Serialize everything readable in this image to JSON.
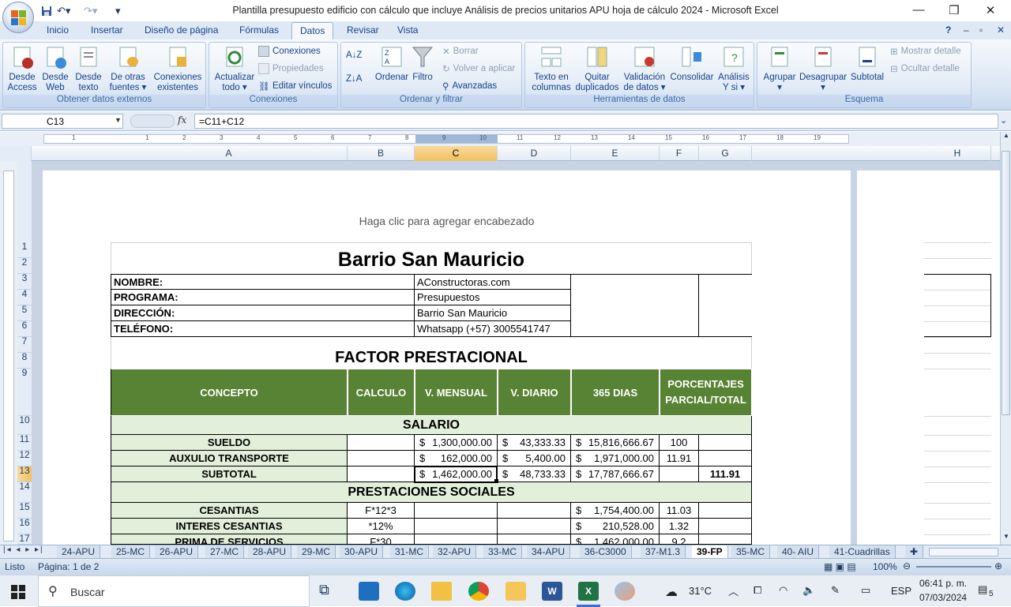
{
  "window": {
    "title": "Plantilla presupuesto edificio con cálculo que incluye Análisis de precios unitarios APU  hoja de cálculo 2024 - Microsoft Excel"
  },
  "ribbon": {
    "tabs": [
      "Inicio",
      "Insertar",
      "Diseño de página",
      "Fórmulas",
      "Datos",
      "Revisar",
      "Vista"
    ],
    "active_tab": "Datos",
    "groups": {
      "external": {
        "label": "Obtener datos externos",
        "buttons": [
          [
            "Desde",
            "Access"
          ],
          [
            "Desde",
            "Web"
          ],
          [
            "Desde",
            "texto"
          ],
          [
            "De otras",
            "fuentes ▾"
          ],
          [
            "Conexiones",
            "existentes"
          ]
        ]
      },
      "connections": {
        "label": "Conexiones",
        "refresh": [
          "Actualizar",
          "todo ▾"
        ],
        "small": [
          "Conexiones",
          "Propiedades",
          "Editar vínculos"
        ]
      },
      "sort": {
        "label": "Ordenar y filtrar",
        "sort": "Ordenar",
        "filter": "Filtro",
        "small": [
          "Borrar",
          "Volver a aplicar",
          "Avanzadas"
        ]
      },
      "tools": {
        "label": "Herramientas de datos",
        "buttons": [
          [
            "Texto en",
            "columnas"
          ],
          [
            "Quitar",
            "duplicados"
          ],
          [
            "Validación",
            "de datos ▾"
          ],
          [
            "Consolidar",
            ""
          ],
          [
            "Análisis",
            "Y si ▾"
          ]
        ]
      },
      "outline": {
        "label": "Esquema",
        "buttons": [
          [
            "Agrupar",
            "▾"
          ],
          [
            "Desagrupar",
            "▾"
          ],
          [
            "Subtotal",
            ""
          ]
        ],
        "small": [
          "Mostrar detalle",
          "Ocultar detalle"
        ]
      }
    }
  },
  "formula_bar": {
    "cell": "C13",
    "fx": "fx",
    "formula": "=C11+C12"
  },
  "columns": [
    "A",
    "B",
    "C",
    "D",
    "E",
    "F",
    "G",
    "H"
  ],
  "rows": [
    "1",
    "2",
    "3",
    "4",
    "5",
    "6",
    "7",
    "8",
    "9",
    "10",
    "11",
    "12",
    "13",
    "14",
    "15",
    "16",
    "17"
  ],
  "ruler": [
    "1",
    "1",
    "2",
    "3",
    "4",
    "5",
    "6",
    "7",
    "8",
    "9",
    "10",
    "11",
    "12",
    "13",
    "14",
    "15",
    "16",
    "17",
    "18",
    "19"
  ],
  "page": {
    "header_hint": "Haga clic para agregar encabezado"
  },
  "sheet": {
    "title": "Barrio San Mauricio",
    "info": [
      {
        "label": "NOMBRE:",
        "value": "AConstructoras.com"
      },
      {
        "label": "PROGRAMA:",
        "value": "Presupuestos"
      },
      {
        "label": "DIRECCIÓN:",
        "value": "Barrio San Mauricio"
      },
      {
        "label": "TELÉFONO:",
        "value": "Whatsapp (+57) 3005541747"
      }
    ],
    "section_title": "FACTOR PRESTACIONAL",
    "headers": [
      "CONCEPTO",
      "CALCULO",
      "V. MENSUAL",
      "V. DIARIO",
      "365 DIAS",
      "PORCENTAJES",
      "PARCIAL/TOTAL"
    ],
    "salario": "SALARIO",
    "prestaciones": "PRESTACIONES SOCIALES",
    "currency": "$",
    "rows": [
      {
        "concepto": "SUELDO",
        "calculo": "",
        "mensual": "1,300,000.00",
        "diario": "43,333.33",
        "anual": "15,816,666.67",
        "parcial": "100",
        "total": ""
      },
      {
        "concepto": "AUXULIO TRANSPORTE",
        "calculo": "",
        "mensual": "162,000.00",
        "diario": "5,400.00",
        "anual": "1,971,000.00",
        "parcial": "11.91",
        "total": ""
      },
      {
        "concepto": "SUBTOTAL",
        "calculo": "",
        "mensual": "1,462,000.00",
        "diario": "48,733.33",
        "anual": "17,787,666.67",
        "parcial": "",
        "total": "111.91"
      },
      {
        "concepto": "CESANTIAS",
        "calculo": "F*12*3",
        "mensual": "",
        "diario": "",
        "anual": "1,754,400.00",
        "parcial": "11.03",
        "total": ""
      },
      {
        "concepto": "INTERES CESANTIAS",
        "calculo": "*12%",
        "mensual": "",
        "diario": "",
        "anual": "210,528.00",
        "parcial": "1.32",
        "total": ""
      },
      {
        "concepto": "PRIMA DE SERVICIOS",
        "calculo": "F*30",
        "mensual": "",
        "diario": "",
        "anual": "1,462,000.00",
        "parcial": "9.2",
        "total": ""
      }
    ]
  },
  "sheet_tabs": [
    "24-APU",
    "25-MC",
    "26-APU",
    "27-MC",
    "28-APU",
    "29-MC",
    "30-APU",
    "31-MC",
    "32-APU",
    "33-MC",
    "34-APU",
    "36-C3000",
    "37-M1.3",
    "39-FP",
    "35-MC",
    "40- AIU",
    "41-Cuadrillas"
  ],
  "active_sheet": "39-FP",
  "status": {
    "mode": "Listo",
    "page": "Página: 1 de 2",
    "zoom": "100%"
  },
  "taskbar": {
    "search": "Buscar",
    "temp": "31°C",
    "lang": "ESP",
    "time": "06:41 p. m.",
    "date": "07/03/2024",
    "notif": "5"
  },
  "colors": {
    "header_green": "#588234",
    "light_green": "#e2efda",
    "selection": "#f1c15f"
  }
}
